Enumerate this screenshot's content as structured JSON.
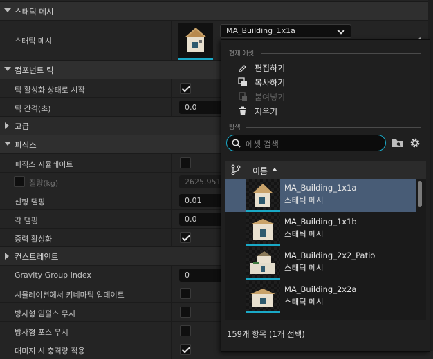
{
  "details": {
    "sections": {
      "static_mesh": "스태틱 메시",
      "component_tick": "컴포넌트 틱",
      "advanced": "고급",
      "physics": "피직스",
      "constraints": "컨스트레인트"
    },
    "rows": {
      "static_mesh": "스태틱 메시",
      "start_with_tick_enabled": "틱 활성화 상태로 시작",
      "tick_interval": "틱 간격(초)",
      "tick_interval_value": "0.0",
      "simulate_physics": "피직스 시뮬레이트",
      "mass": "질량(kg)",
      "mass_value": "2625.9514",
      "linear_damping": "선형 댐핑",
      "linear_damping_value": "0.01",
      "angular_damping": "각 댐핑",
      "angular_damping_value": "0.0",
      "enable_gravity": "중력 활성화",
      "gravity_group_index": "Gravity Group Index",
      "gravity_group_index_value": "0",
      "update_kinematic": "시뮬레이션에서 키네마틱 업데이트",
      "ignore_radial_impulse": "방사형 임펄스 무시",
      "ignore_radial_force": "방사형 포스 무시",
      "apply_impulse_on_damage": "대미지 시 충격량 적용"
    },
    "checks": {
      "start_with_tick_enabled": true,
      "simulate_physics": false,
      "mass_override": false,
      "enable_gravity": true,
      "update_kinematic": false,
      "ignore_radial_impulse": false,
      "ignore_radial_force": false,
      "apply_impulse_on_damage": true
    },
    "mesh_value": "MA_Building_1x1a"
  },
  "picker": {
    "current_asset_label": "현재 에셋",
    "menu": {
      "edit": "편집하기",
      "copy": "복사하기",
      "paste": "붙여넣기",
      "clear": "지우기"
    },
    "browse_label": "탐색",
    "search_placeholder": "에셋 검색",
    "column_name": "이름",
    "assets": [
      {
        "name": "MA_Building_1x1a",
        "type": "스태틱 메시",
        "selected": true
      },
      {
        "name": "MA_Building_1x1b",
        "type": "스태틱 메시",
        "selected": false
      },
      {
        "name": "MA_Building_2x2_Patio",
        "type": "스태틱 메시",
        "selected": false
      },
      {
        "name": "MA_Building_2x2a",
        "type": "스태틱 메시",
        "selected": false
      }
    ],
    "footer": "159개 항목 (1개 선택)"
  },
  "icons": [
    "pencil-icon",
    "copy-icon",
    "paste-icon",
    "trash-icon",
    "search-icon",
    "folder-icon",
    "gear-icon",
    "branch-icon",
    "sort-asc-icon",
    "chevron-down-icon",
    "checkmark-icon"
  ],
  "colors": {
    "accent": "#1aa9c7",
    "selection": "#485c76",
    "panel": "#242424",
    "section_header": "#2f2f2f"
  }
}
